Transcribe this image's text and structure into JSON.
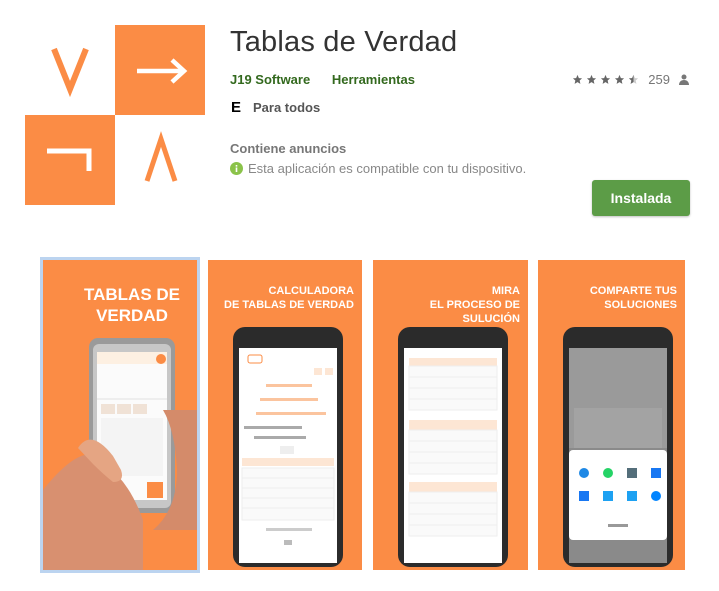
{
  "app": {
    "title": "Tablas de Verdad",
    "developer": "J19 Software",
    "category": "Herramientas",
    "rating_count": "259",
    "content_rating": "Para todos",
    "content_rating_icon": "esrb-e-icon",
    "ads_notice": "Contiene anuncios",
    "compatibility": "Esta aplicación es compatible con tu dispositivo.",
    "install_label": "Instalada",
    "stars": 4.5
  },
  "icon_glyphs": {
    "or": "V",
    "arrow": "→",
    "not": "¬",
    "and": "Λ"
  },
  "screenshots": [
    {
      "caption_line1": "TABLAS DE",
      "caption_line2": "VERDAD"
    },
    {
      "caption_line1": "CALCULADORA",
      "caption_line2": "DE TABLAS DE VERDAD"
    },
    {
      "caption_line1": "MIRA",
      "caption_line2": "EL PROCESO DE SULUCIÓN"
    },
    {
      "caption_line1": "COMPARTE TUS",
      "caption_line2": "SOLUCIONES"
    }
  ],
  "colors": {
    "brand_orange": "#fb8c45",
    "install_green": "#5c9c47",
    "dev_green": "#33691e"
  }
}
